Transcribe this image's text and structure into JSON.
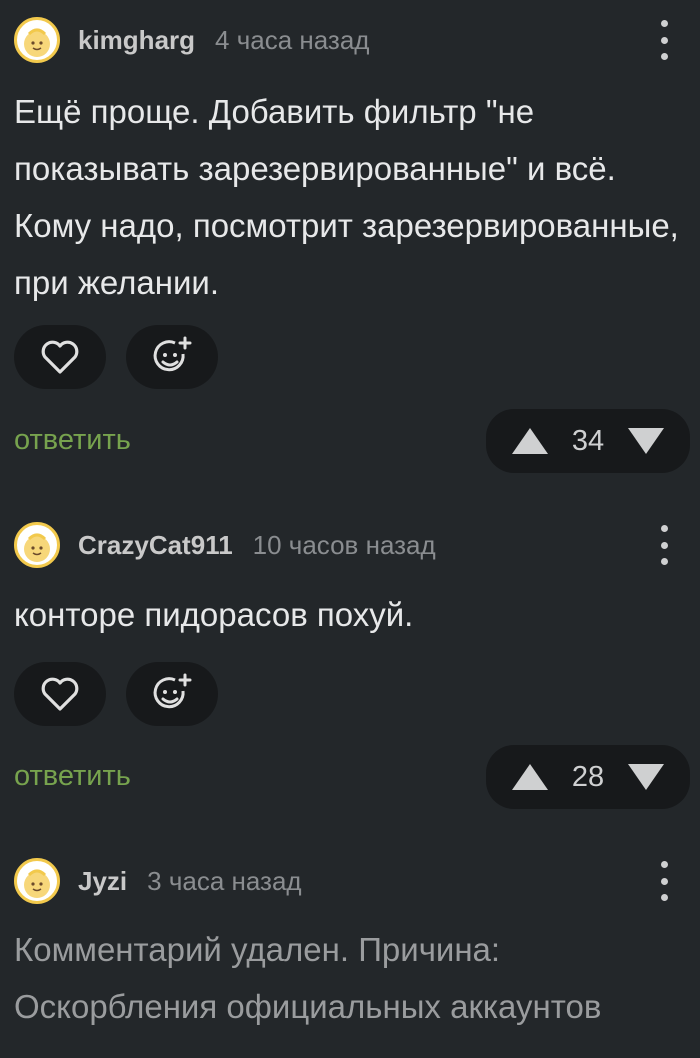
{
  "comments": [
    {
      "username": "kimgharg",
      "time": "4 часа назад",
      "text": "Ещё проще. Добавить фильтр \"не показывать зарезервированные\" и всё. Кому надо, посмотрит зарезервированные, при желании.",
      "reply_label": "ответить",
      "rating": "34"
    },
    {
      "username": "CrazyCat911",
      "time": "10 часов назад",
      "text": "конторе пидорасов похуй.",
      "reply_label": "ответить",
      "rating": "28"
    },
    {
      "username": "Jyzi",
      "time": "3 часа назад",
      "text": "Комментарий удален. Причина: Оскорбления официальных аккаунтов"
    }
  ],
  "icons": {
    "like": "heart-icon",
    "reaction": "add-emoji-icon",
    "more": "more-vertical-icon",
    "upvote": "triangle-up-icon",
    "downvote": "triangle-down-icon",
    "avatar": "default-avatar-icon"
  },
  "colors": {
    "background": "#23272a",
    "reply_link": "#77a34e",
    "pill_background": "#17191b",
    "avatar_border": "#f2c94c"
  }
}
